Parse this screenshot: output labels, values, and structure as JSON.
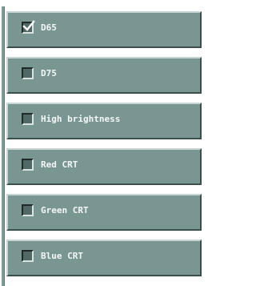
{
  "options": [
    {
      "label": "D65",
      "checked": true
    },
    {
      "label": "D75",
      "checked": false
    },
    {
      "label": "High brightness",
      "checked": false
    },
    {
      "label": "Red CRT",
      "checked": false
    },
    {
      "label": "Green CRT",
      "checked": false
    },
    {
      "label": "Blue CRT",
      "checked": false
    }
  ],
  "colors": {
    "row_background": "#7a9693",
    "row_highlight": "#c7d6d4",
    "row_shadow": "#3b4f4d",
    "checkbox_fill": "#516866",
    "check_mark": "#ffffff",
    "label_text": "#f3f7f6"
  },
  "icons": {
    "checked": "check-mark-icon"
  }
}
